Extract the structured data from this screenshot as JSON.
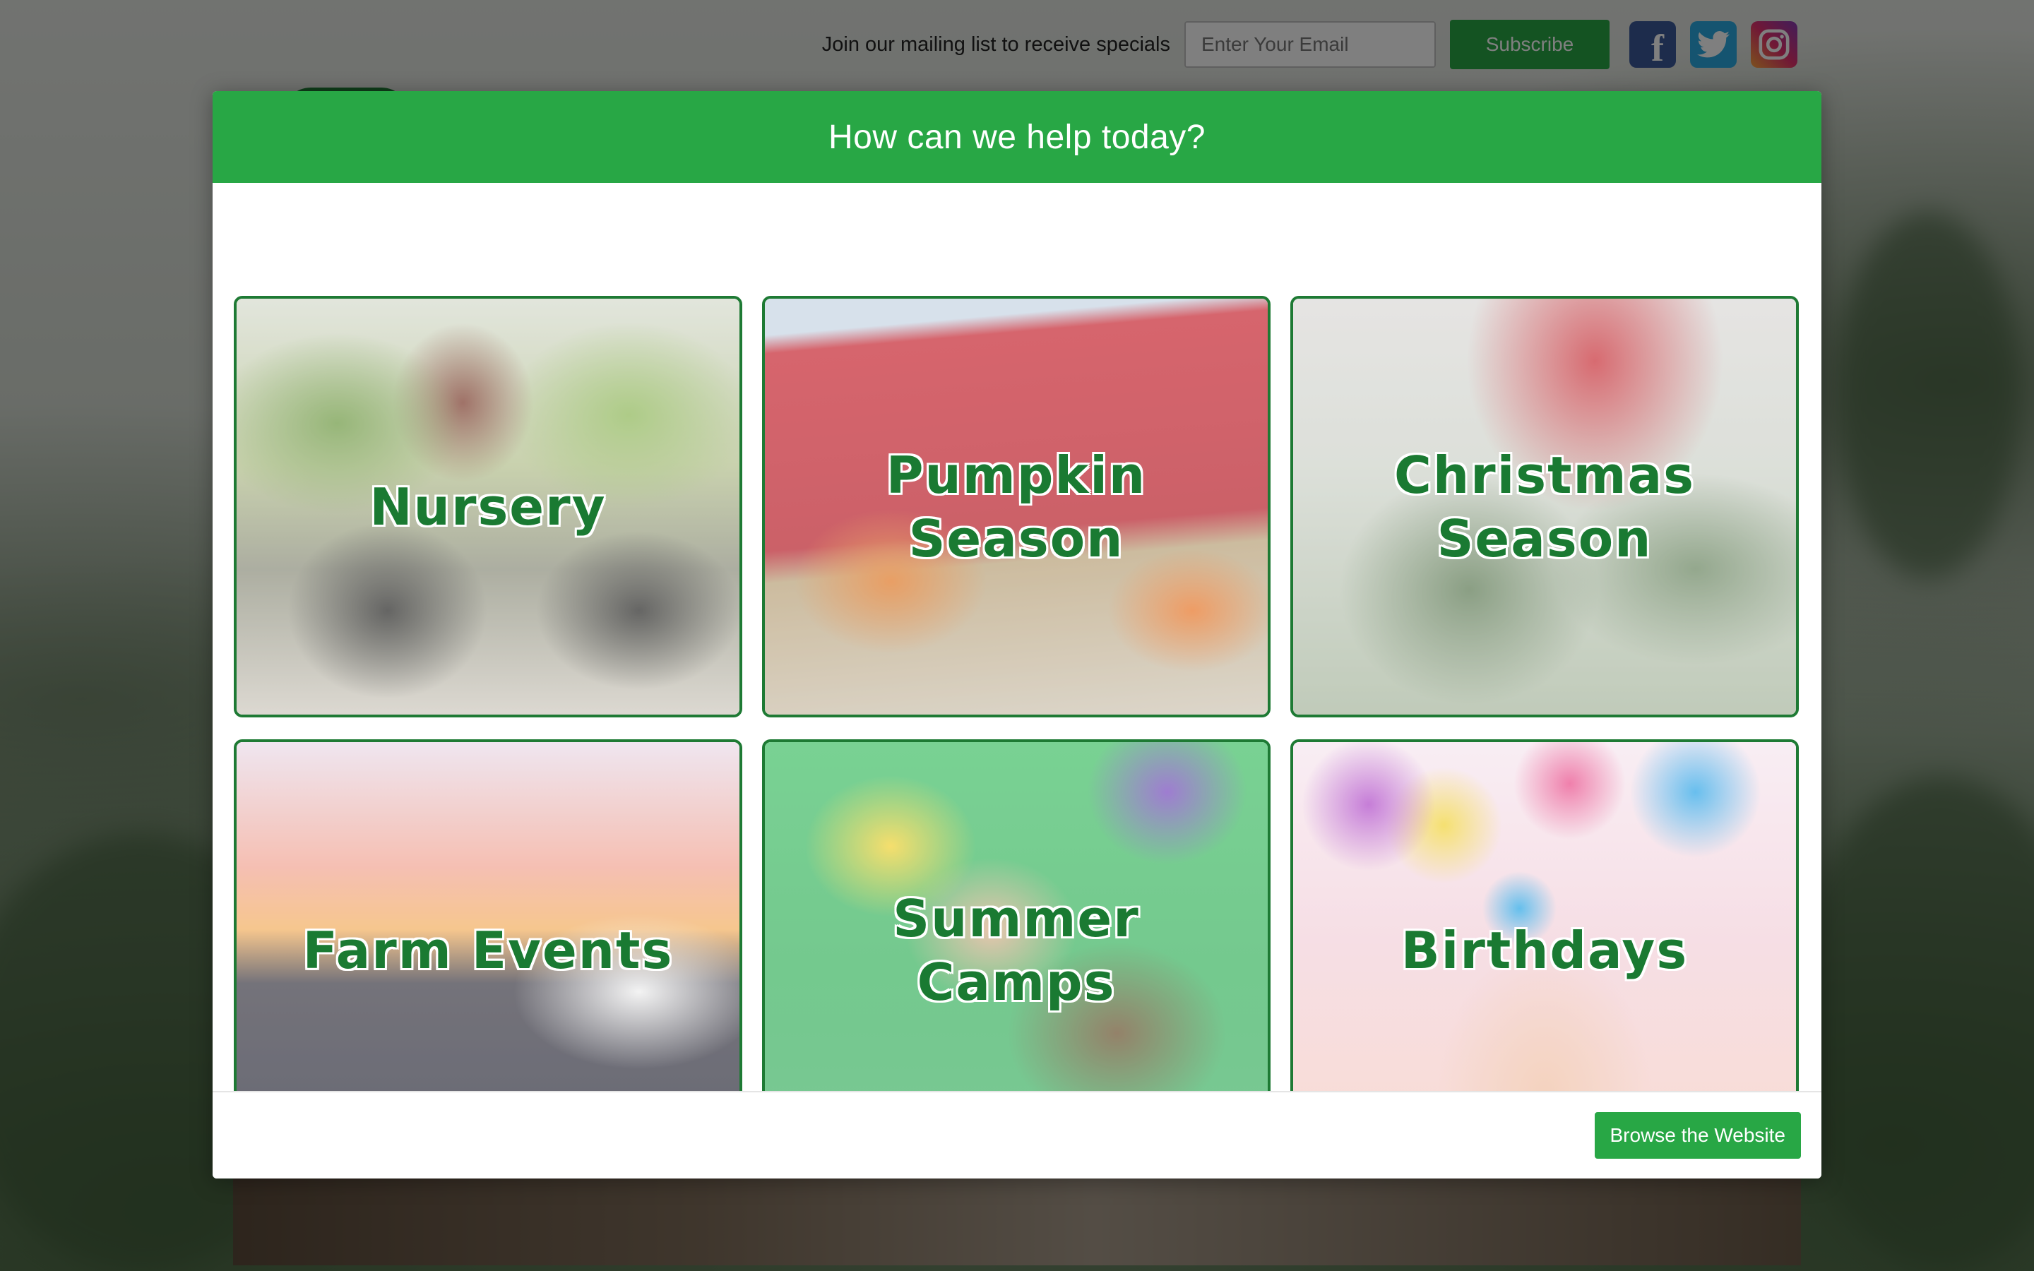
{
  "mailing": {
    "label": "Join our mailing list to receive specials",
    "email_placeholder": "Enter Your Email",
    "subscribe_label": "Subscribe"
  },
  "social": {
    "facebook_glyph": "f",
    "icons": [
      "facebook-icon",
      "twitter-icon",
      "instagram-icon"
    ]
  },
  "modal": {
    "title": "How can we help today?",
    "tiles": [
      {
        "label": "Nursery"
      },
      {
        "label": "Pumpkin Season"
      },
      {
        "label": "Christmas Season"
      },
      {
        "label": "Farm Events"
      },
      {
        "label": "Summer Camps"
      },
      {
        "label": "Birthdays"
      }
    ],
    "browse_label": "Browse the Website"
  },
  "colors": {
    "accent_green": "#28a745",
    "tile_border": "#1e7a34",
    "tile_text": "#1a7a32"
  }
}
